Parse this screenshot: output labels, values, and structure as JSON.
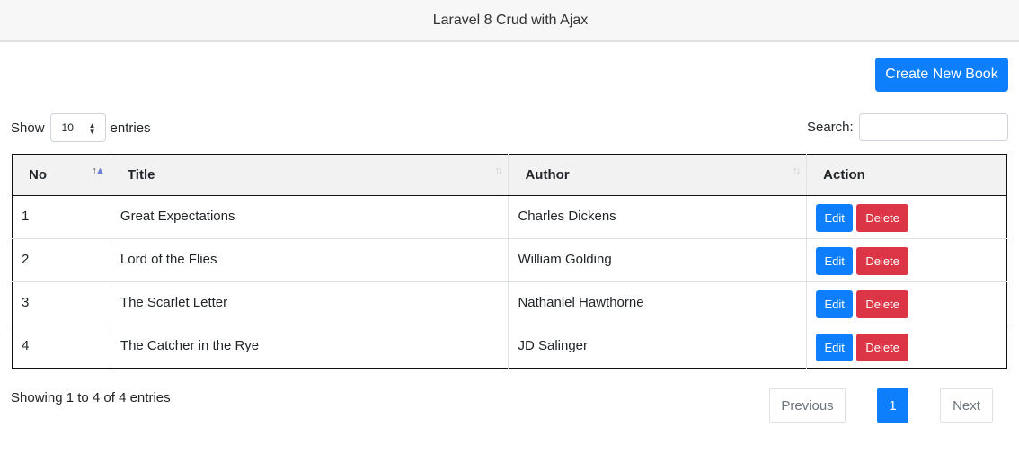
{
  "navbar": {
    "title": "Laravel 8 Crud with Ajax"
  },
  "toolbar": {
    "create_label": "Create New Book"
  },
  "length": {
    "prefix": "Show",
    "value": "10",
    "suffix": "entries"
  },
  "search": {
    "label": "Search:",
    "value": ""
  },
  "table": {
    "headers": [
      "No",
      "Title",
      "Author",
      "Action"
    ],
    "rows": [
      {
        "no": "1",
        "title": "Great Expectations",
        "author": "Charles Dickens"
      },
      {
        "no": "2",
        "title": "Lord of the Flies",
        "author": "William Golding"
      },
      {
        "no": "3",
        "title": "The Scarlet Letter",
        "author": "Nathaniel Hawthorne"
      },
      {
        "no": "4",
        "title": "The Catcher in the Rye",
        "author": "JD Salinger"
      }
    ],
    "edit_label": "Edit",
    "delete_label": "Delete"
  },
  "footer": {
    "info": "Showing 1 to 4 of 4 entries",
    "prev": "Previous",
    "page": "1",
    "next": "Next"
  },
  "colors": {
    "primary": "#0d7efc",
    "danger": "#dc3545",
    "navbar_bg": "#f7f7f7"
  }
}
